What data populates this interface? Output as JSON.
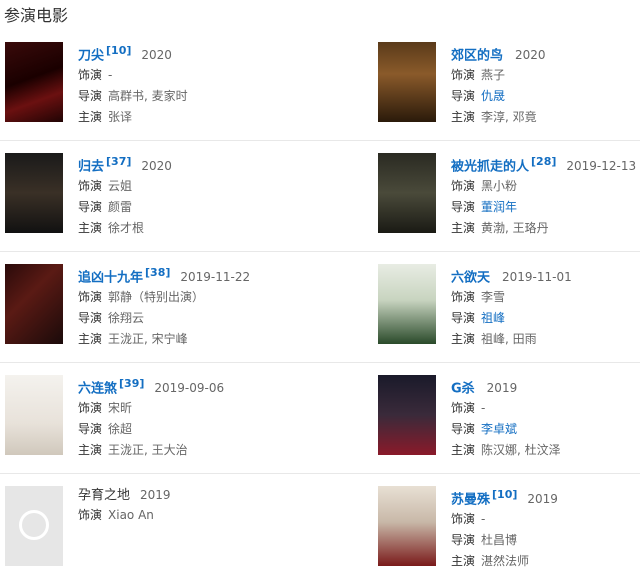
{
  "section_title": "参演电影",
  "labels": {
    "role": "饰演",
    "director": "导演",
    "cast": "主演"
  },
  "movies": [
    {
      "title": "刀尖",
      "ref": "[10]",
      "date": "2020",
      "role": "-",
      "director": "高群书, 麦家时",
      "cast": "张译"
    },
    {
      "title": "郊区的鸟",
      "ref": "",
      "date": "2020",
      "role": "燕子",
      "director": "仇晟",
      "cast": "李淳, 邓竟"
    },
    {
      "title": "归去",
      "ref": "[37]",
      "date": "2020",
      "role": "云姐",
      "director": "颜雷",
      "cast": "徐才根"
    },
    {
      "title": "被光抓走的人",
      "ref": "[28]",
      "date": "2019-12-13",
      "role": "黑小粉",
      "director": "董润年",
      "cast": "黄渤, 王珞丹"
    },
    {
      "title": "追凶十九年",
      "ref": "[38]",
      "date": "2019-11-22",
      "role": "郭静（特别出演）",
      "director": "徐翔云",
      "cast": "王泷正, 宋宁峰"
    },
    {
      "title": "六欲天",
      "ref": "",
      "date": "2019-11-01",
      "role": "李雪",
      "director": "祖峰",
      "cast": "祖峰, 田雨"
    },
    {
      "title": "六连煞",
      "ref": "[39]",
      "date": "2019-09-06",
      "role": "宋昕",
      "director": "徐超",
      "cast": "王泷正, 王大治"
    },
    {
      "title": "G杀",
      "ref": "",
      "date": "2019",
      "role": "-",
      "director": "李卓斌",
      "cast": "陈汉娜, 杜汶泽"
    },
    {
      "title": "孕育之地",
      "ref": "",
      "date": "2019",
      "role": "Xiao An",
      "director": "",
      "cast": ""
    },
    {
      "title": "苏曼殊",
      "ref": "[10]",
      "date": "2019",
      "role": "-",
      "director": "杜昌博",
      "cast": "湛然法师"
    }
  ]
}
